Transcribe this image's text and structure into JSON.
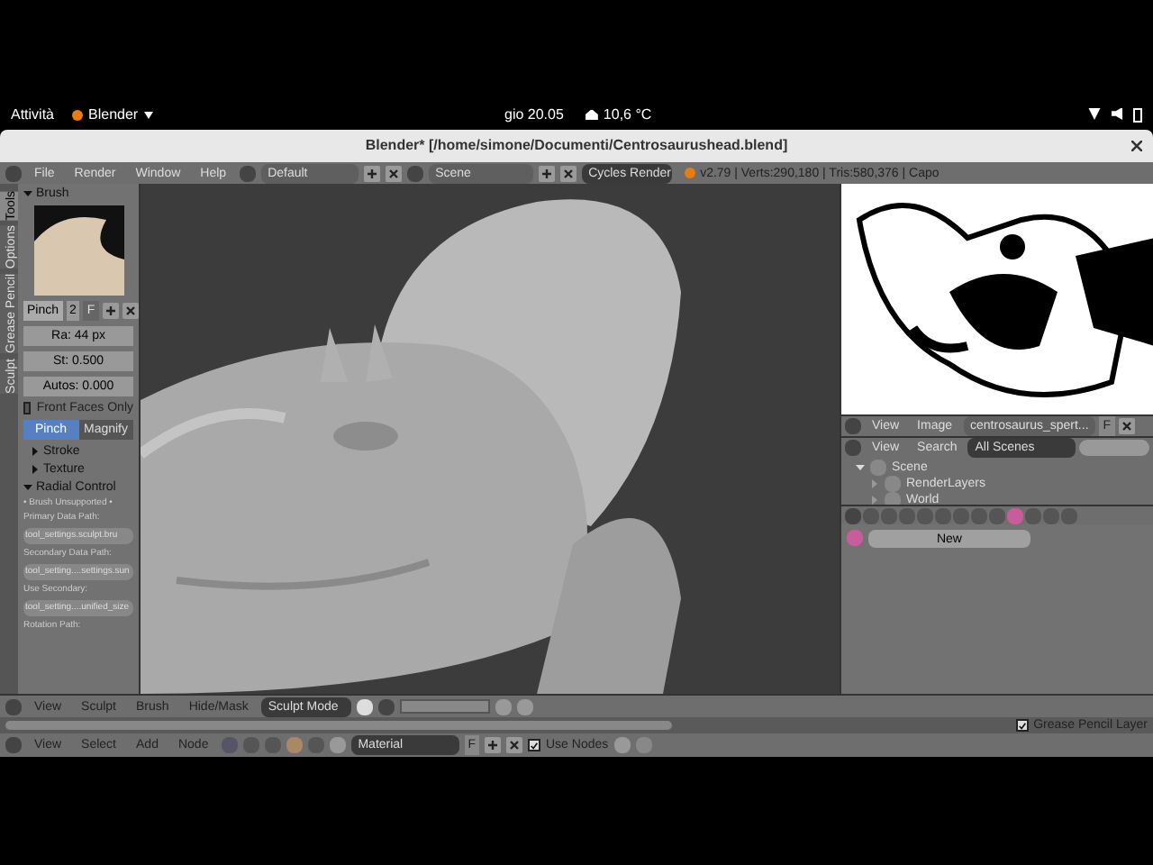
{
  "topbar": {
    "activities": "Attività",
    "app": "Blender",
    "clock": "gio 20.05",
    "weather": "10,6 °C"
  },
  "window": {
    "title": "Blender* [/home/simone/Documenti/Centrosaurushead.blend]"
  },
  "info_header": {
    "menus": [
      "File",
      "Render",
      "Window",
      "Help"
    ],
    "layout": "Default",
    "scene": "Scene",
    "engine": "Cycles Render",
    "stats": "v2.79 | Verts:290,180 | Tris:580,376 | Capo"
  },
  "tool_tabs": [
    {
      "label": "Tools",
      "selected": true
    },
    {
      "label": "Options",
      "selected": false
    },
    {
      "label": "Grease Pencil",
      "selected": false
    },
    {
      "label": "Sculpt",
      "selected": false
    }
  ],
  "brush": {
    "title": "Brush",
    "name": "Pinch",
    "users": "2",
    "fake": "F",
    "fields": [
      "Ra: 44 px",
      "St: 0.500",
      "Autos: 0.000"
    ],
    "front_faces": {
      "label": "Front Faces Only",
      "checked": false
    },
    "modes": [
      {
        "label": "Pinch",
        "selected": true
      },
      {
        "label": "Magnify",
        "selected": false
      }
    ]
  },
  "sections": [
    {
      "label": "Stroke",
      "expanded": false
    },
    {
      "label": "Texture",
      "expanded": false
    },
    {
      "label": "Radial Control",
      "expanded": true
    }
  ],
  "radial_control": [
    {
      "kind": "note",
      "text": "• Brush Unsupported •"
    },
    {
      "kind": "label",
      "text": "Primary Data Path:"
    },
    {
      "kind": "field",
      "text": "tool_settings.sculpt.bru"
    },
    {
      "kind": "label",
      "text": "Secondary Data Path:"
    },
    {
      "kind": "field",
      "text": "tool_setting....settings.sun"
    },
    {
      "kind": "label",
      "text": "Use Secondary:"
    },
    {
      "kind": "field",
      "text": "tool_setting....unified_size"
    },
    {
      "kind": "label",
      "text": "Rotation Path:"
    }
  ],
  "viewport_header": {
    "menus": [
      "View",
      "Sculpt",
      "Brush",
      "Hide/Mask"
    ],
    "mode": "Sculpt Mode"
  },
  "timeline": {
    "grease_pencil": {
      "label": "Grease Pencil Layer",
      "checked": true
    }
  },
  "node_header": {
    "menus": [
      "View",
      "Select",
      "Add",
      "Node"
    ],
    "material": "Material",
    "fake": "F",
    "use_nodes": {
      "label": "Use Nodes",
      "checked": true
    }
  },
  "image_header": {
    "menus": [
      "View",
      "Image"
    ],
    "image": "centrosaurus_spert...",
    "fake": "F"
  },
  "outliner": {
    "menus": [
      "View",
      "Search"
    ],
    "filter": "All Scenes",
    "tree": [
      {
        "label": "Scene",
        "expanded": true,
        "children": [
          {
            "label": "RenderLayers",
            "expanded": false
          },
          {
            "label": "World",
            "expanded": false
          }
        ]
      }
    ]
  },
  "properties": {
    "new_button": "New"
  }
}
